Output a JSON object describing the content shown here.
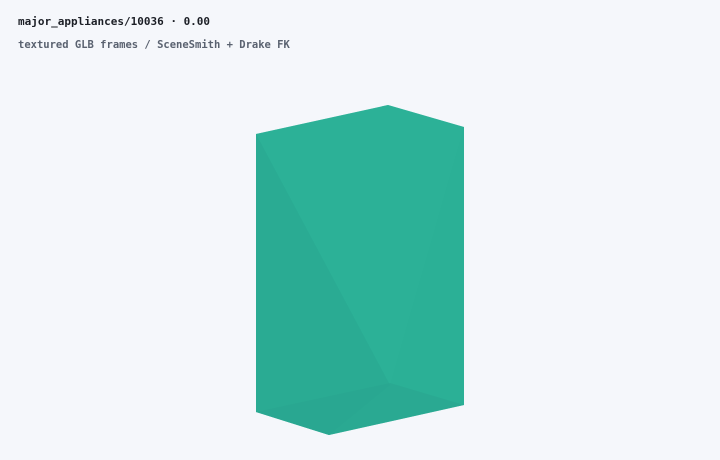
{
  "viewer": {
    "title": "major_appliances/10036 · 0.00",
    "subtitle": "textured GLB frames / SceneSmith + Drake FK"
  },
  "colors": {
    "background": "#f5f7fb",
    "model_main": "#2bb096",
    "model_shade": "#2aa892",
    "model_light": "#2fb399",
    "model_edge": "#29a58f"
  },
  "model": {
    "kind": "appliance-box"
  }
}
